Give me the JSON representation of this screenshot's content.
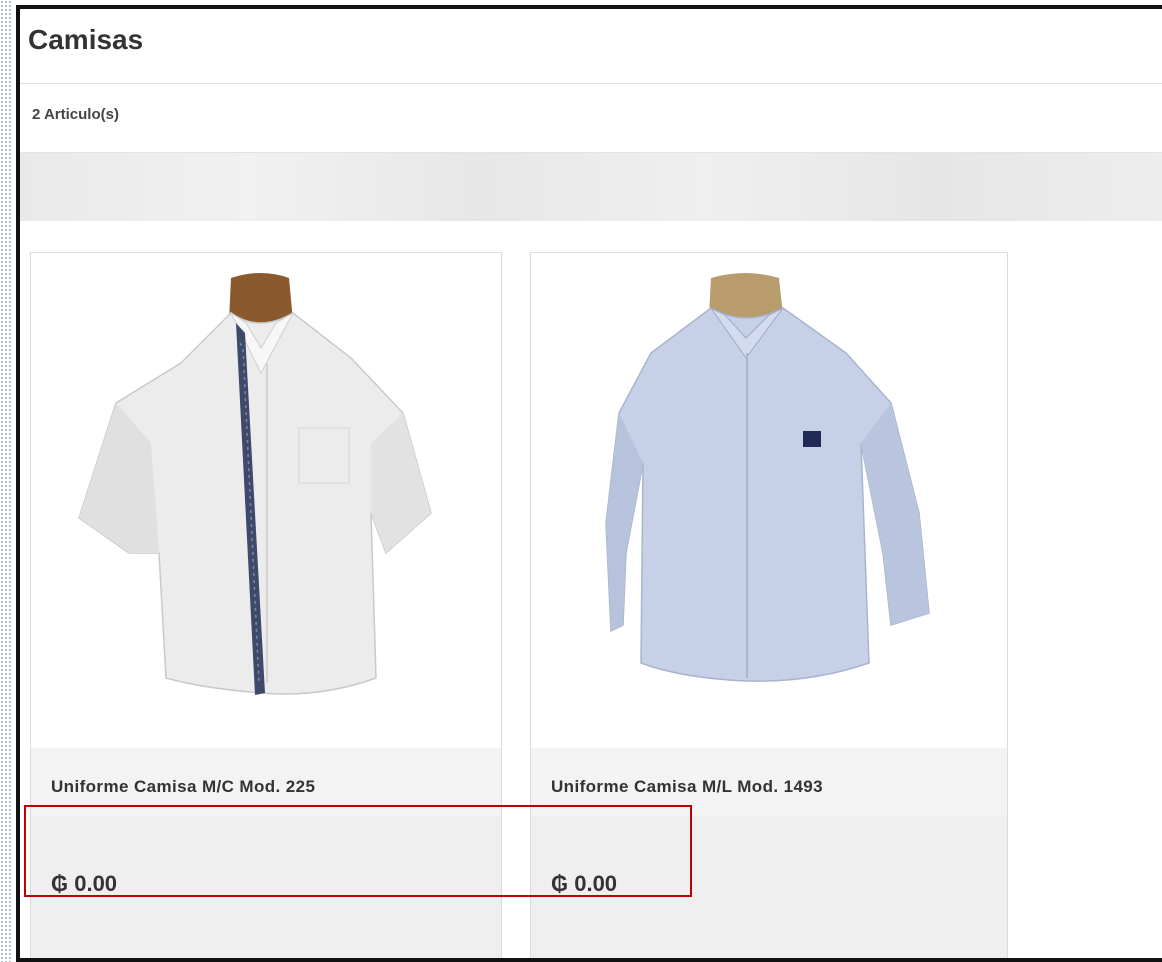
{
  "page": {
    "title": "Camisas",
    "item_count": "2 Articulo(s)"
  },
  "products": [
    {
      "name": "Uniforme Camisa M/C Mod. 225",
      "price": "₲ 0.00",
      "image_icon": "white-short-sleeve-shirt-icon"
    },
    {
      "name": "Uniforme Camisa M/L Mod. 1493",
      "price": "₲ 0.00",
      "image_icon": "light-blue-long-sleeve-shirt-icon"
    }
  ],
  "colors": {
    "highlight_border": "#c00000",
    "text": "#333333"
  }
}
